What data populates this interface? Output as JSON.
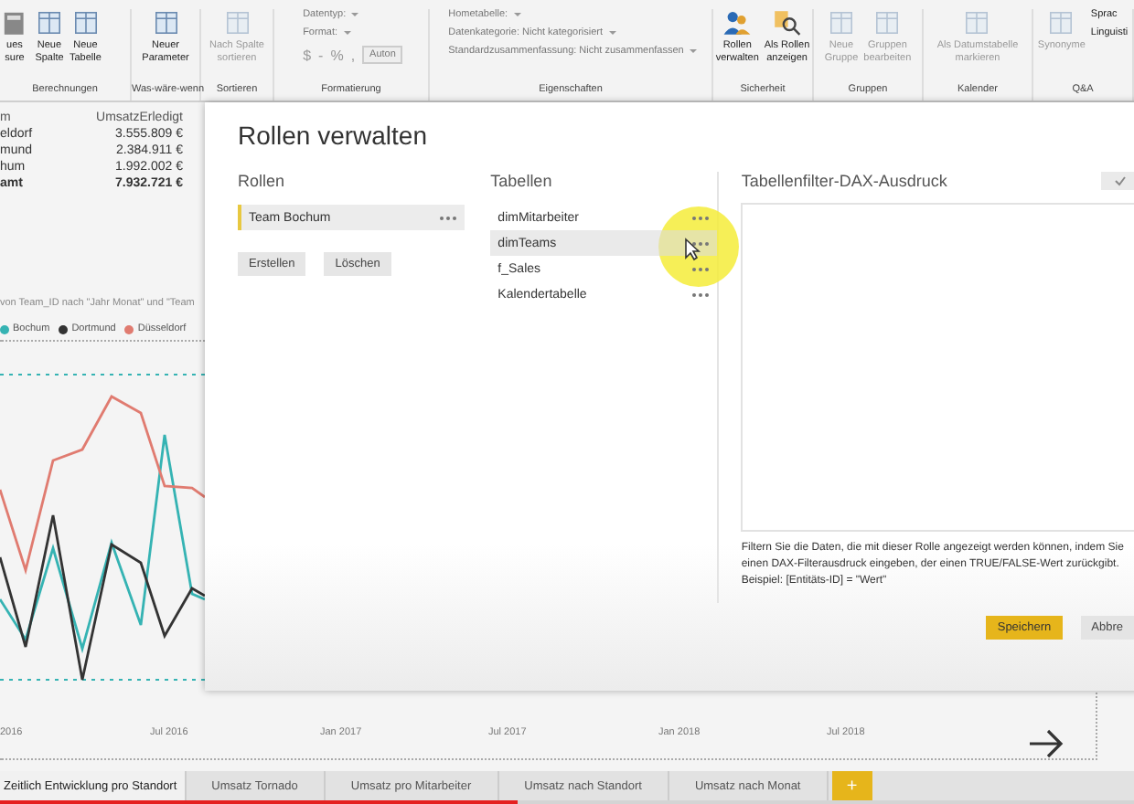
{
  "ribbon": {
    "groups": [
      {
        "label": "Berechnungen",
        "buttons": [
          {
            "lines": [
              "ues",
              "sure"
            ],
            "disabled": false
          },
          {
            "lines": [
              "Neue",
              "Spalte"
            ],
            "disabled": false
          },
          {
            "lines": [
              "Neue",
              "Tabelle"
            ],
            "disabled": false
          }
        ]
      },
      {
        "label": "Was-wäre-wenn",
        "buttons": [
          {
            "lines": [
              "Neuer",
              "Parameter"
            ],
            "disabled": false
          }
        ]
      },
      {
        "label": "Sortieren",
        "buttons": [
          {
            "lines": [
              "Nach Spalte",
              "sortieren"
            ],
            "disabled": true
          }
        ]
      },
      {
        "label": "Formatierung",
        "fields": [
          {
            "label": "Datentyp:"
          },
          {
            "label": "Format:"
          }
        ],
        "format_symbols": [
          "$",
          "-",
          "%",
          ","
        ],
        "auto_field": "Auton"
      },
      {
        "label": "Eigenschaften",
        "fields": [
          {
            "label": "Hometabelle:"
          },
          {
            "label": "Datenkategorie: Nicht kategorisiert"
          },
          {
            "label": "Standardzusammenfassung: Nicht zusammenfassen"
          }
        ]
      },
      {
        "label": "Sicherheit",
        "buttons": [
          {
            "lines": [
              "Rollen",
              "verwalten"
            ],
            "disabled": false
          },
          {
            "lines": [
              "Als Rollen",
              "anzeigen"
            ],
            "disabled": false
          }
        ]
      },
      {
        "label": "Gruppen",
        "buttons": [
          {
            "lines": [
              "Neue",
              "Gruppe"
            ],
            "disabled": true
          },
          {
            "lines": [
              "Gruppen",
              "bearbeiten"
            ],
            "disabled": true
          }
        ]
      },
      {
        "label": "Kalender",
        "buttons": [
          {
            "lines": [
              "Als Datumstabelle",
              "markieren"
            ],
            "disabled": true
          }
        ]
      },
      {
        "label": "Q&A",
        "buttons": [
          {
            "lines": [
              "Synonyme"
            ],
            "disabled": true
          }
        ],
        "small_items": [
          "Sprac",
          "Linguisti"
        ]
      }
    ]
  },
  "table": {
    "columns": [
      "m",
      "UmsatzErledigt"
    ],
    "rows": [
      {
        "cells": [
          "eldorf",
          "3.555.809 €"
        ],
        "total": false
      },
      {
        "cells": [
          "mund",
          "2.384.911 €"
        ],
        "total": false
      },
      {
        "cells": [
          "hum",
          "1.992.002 €"
        ],
        "total": false
      },
      {
        "cells": [
          "amt",
          "7.932.721 €"
        ],
        "total": true
      }
    ]
  },
  "line_chart": {
    "title": "von Team_ID nach \"Jahr Monat\" und \"Team",
    "legend": [
      {
        "name": "Bochum",
        "color": "#35b3b3"
      },
      {
        "name": "Dortmund",
        "color": "#333333"
      },
      {
        "name": "Düsseldorf",
        "color": "#e07b70"
      }
    ],
    "x_labels": [
      "2016",
      "Jul 2016",
      "Jan 2017",
      "Jul 2017",
      "Jan 2018",
      "Jul 2018"
    ]
  },
  "dialog": {
    "title": "Rollen verwalten",
    "roles": {
      "heading": "Rollen",
      "items": [
        {
          "label": "Team Bochum",
          "selected": true
        }
      ],
      "buttons": [
        "Erstellen",
        "Löschen"
      ]
    },
    "tables": {
      "heading": "Tabellen",
      "items": [
        {
          "label": "dimMitarbeiter",
          "selected": false
        },
        {
          "label": "dimTeams",
          "selected": true
        },
        {
          "label": "f_Sales",
          "selected": false
        },
        {
          "label": "Kalendertabelle",
          "selected": false
        }
      ]
    },
    "dax": {
      "heading": "Tabellenfilter-DAX-Ausdruck",
      "help": "Filtern Sie die Daten, die mit dieser Rolle angezeigt werden können, indem Sie einen DAX-Filterausdruck eingeben, der einen TRUE/FALSE-Wert zurückgibt. Beispiel: [Entitäts-ID] = \"Wert\""
    },
    "buttons": [
      {
        "label": "Speichern",
        "primary": true
      },
      {
        "label": "Abbre",
        "primary": false
      }
    ]
  },
  "page_tabs": [
    {
      "label": "Zeitlich Entwicklung pro Standort",
      "selected": true
    },
    {
      "label": "Umsatz Tornado",
      "selected": false
    },
    {
      "label": "Umsatz pro Mitarbeiter",
      "selected": false
    },
    {
      "label": "Umsatz nach Standort",
      "selected": false
    },
    {
      "label": "Umsatz nach Monat",
      "selected": false
    }
  ],
  "add_tab": "+",
  "video_progress": {
    "level": 0.456
  }
}
